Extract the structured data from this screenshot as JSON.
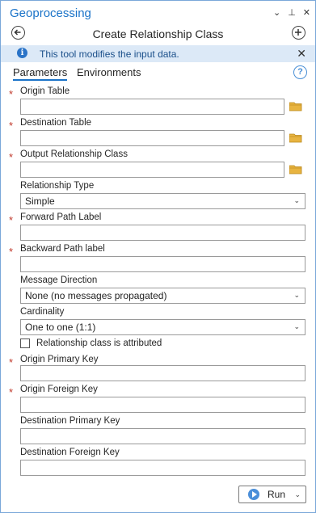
{
  "pane_title": "Geoprocessing",
  "window_controls": {
    "dropdown": "⌄",
    "pin": "⊥",
    "close": "✕"
  },
  "tool": {
    "name": "Create Relationship Class"
  },
  "info_bar": {
    "text": "This tool modifies the input data.",
    "close": "✕"
  },
  "tabs": [
    {
      "label": "Parameters",
      "active": true
    },
    {
      "label": "Environments",
      "active": false
    }
  ],
  "help_label": "?",
  "parameters": {
    "origin_table": {
      "label": "Origin Table",
      "value": ""
    },
    "destination_table": {
      "label": "Destination Table",
      "value": ""
    },
    "output_relationship_class": {
      "label": "Output Relationship Class",
      "value": ""
    },
    "relationship_type": {
      "label": "Relationship Type",
      "value": "Simple"
    },
    "forward_path_label": {
      "label": "Forward Path Label",
      "value": ""
    },
    "backward_path_label": {
      "label": "Backward Path label",
      "value": ""
    },
    "message_direction": {
      "label": "Message Direction",
      "value": "None (no messages propagated)"
    },
    "cardinality": {
      "label": "Cardinality",
      "value": "One to one (1:1)"
    },
    "attributed": {
      "label": "Relationship class is attributed",
      "checked": false
    },
    "origin_primary_key": {
      "label": "Origin Primary Key",
      "value": ""
    },
    "origin_foreign_key": {
      "label": "Origin Foreign Key",
      "value": ""
    },
    "destination_primary_key": {
      "label": "Destination Primary Key",
      "value": ""
    },
    "destination_foreign_key": {
      "label": "Destination Foreign Key",
      "value": ""
    }
  },
  "required_marker": "*",
  "run_button": {
    "label": "Run"
  },
  "colors": {
    "accent": "#1a73c8",
    "info_bg": "#dce9f7",
    "required": "#c0392b",
    "folder": "#e8b440"
  }
}
